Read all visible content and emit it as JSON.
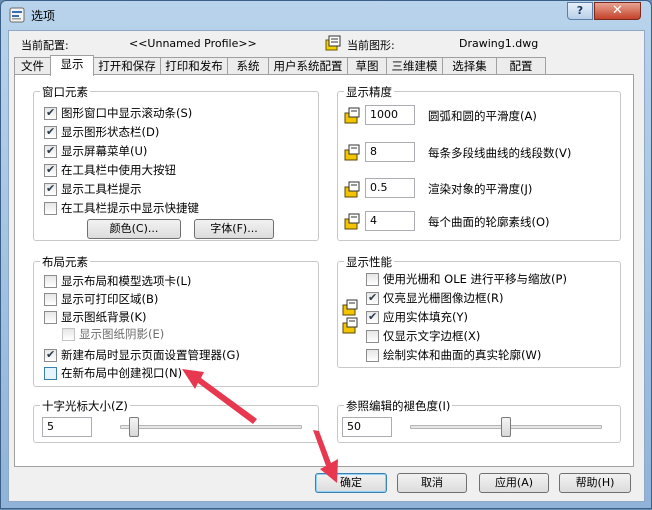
{
  "window": {
    "title": "选项",
    "help_label": "?",
    "close_label": "✕"
  },
  "profile": {
    "current_profile_label": "当前配置:",
    "current_profile_value": "<<Unnamed Profile>>",
    "current_drawing_label": "当前图形:",
    "current_drawing_value": "Drawing1.dwg"
  },
  "tabs": [
    {
      "label": "文件"
    },
    {
      "label": "显示"
    },
    {
      "label": "打开和保存"
    },
    {
      "label": "打印和发布"
    },
    {
      "label": "系统"
    },
    {
      "label": "用户系统配置"
    },
    {
      "label": "草图"
    },
    {
      "label": "三维建模"
    },
    {
      "label": "选择集"
    },
    {
      "label": "配置"
    }
  ],
  "window_elements": {
    "title": "窗口元素",
    "items": [
      {
        "label": "图形窗口中显示滚动条(S)",
        "checked": true
      },
      {
        "label": "显示图形状态栏(D)",
        "checked": true
      },
      {
        "label": "显示屏幕菜单(U)",
        "checked": true
      },
      {
        "label": "在工具栏中使用大按钮",
        "checked": true
      },
      {
        "label": "显示工具栏提示",
        "checked": true
      },
      {
        "label": "在工具栏提示中显示快捷键",
        "checked": false
      }
    ],
    "color_button": "颜色(C)...",
    "font_button": "字体(F)..."
  },
  "layout_elements": {
    "title": "布局元素",
    "items": [
      {
        "label": "显示布局和模型选项卡(L)",
        "checked": false
      },
      {
        "label": "显示可打印区域(B)",
        "checked": false
      },
      {
        "label": "显示图纸背景(K)",
        "checked": false
      },
      {
        "label": "显示图纸阴影(E)",
        "checked": false
      },
      {
        "label": "新建布局时显示页面设置管理器(G)",
        "checked": true
      },
      {
        "label": "在新布局中创建视口(N)",
        "checked": false
      }
    ]
  },
  "precision": {
    "title": "显示精度",
    "items": [
      {
        "value": "1000",
        "label": "圆弧和圆的平滑度(A)"
      },
      {
        "value": "8",
        "label": "每条多段线曲线的线段数(V)"
      },
      {
        "value": "0.5",
        "label": "渲染对象的平滑度(J)"
      },
      {
        "value": "4",
        "label": "每个曲面的轮廓素线(O)"
      }
    ]
  },
  "performance": {
    "title": "显示性能",
    "items": [
      {
        "label": "使用光栅和 OLE 进行平移与缩放(P)",
        "checked": false
      },
      {
        "label": "仅亮显光栅图像边框(R)",
        "checked": true
      },
      {
        "label": "应用实体填充(Y)",
        "checked": true
      },
      {
        "label": "仅显示文字边框(X)",
        "checked": false
      },
      {
        "label": "绘制实体和曲面的真实轮廓(W)",
        "checked": false
      }
    ]
  },
  "crosshair": {
    "title": "十字光标大小(Z)",
    "value": "5",
    "level_percent": 5
  },
  "xref_fade": {
    "title": "参照编辑的褪色度(I)",
    "value": "50",
    "level_percent": 50
  },
  "footer": {
    "ok": "确定",
    "cancel": "取消",
    "apply": "应用(A)",
    "help": "帮助(H)"
  },
  "colors": {
    "arrow": "#e8384f",
    "focus_border": "#3c7fb1"
  }
}
